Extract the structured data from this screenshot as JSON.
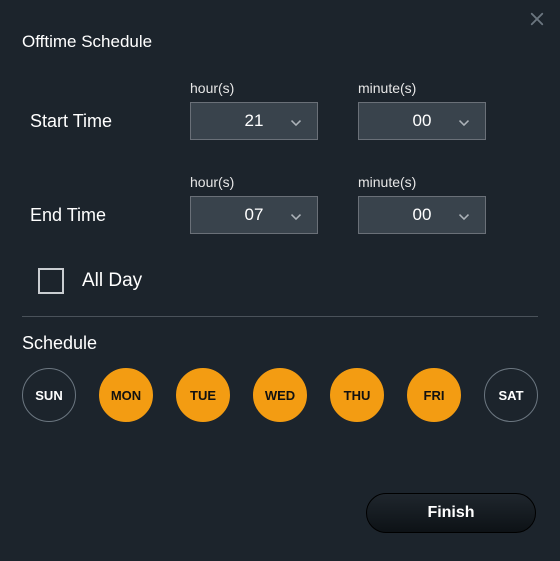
{
  "title": "Offtime Schedule",
  "labels": {
    "startTime": "Start Time",
    "endTime": "End Time",
    "hours": "hour(s)",
    "minutes": "minute(s)",
    "allDay": "All Day",
    "schedule": "Schedule",
    "finish": "Finish"
  },
  "startHour": "21",
  "startMinute": "00",
  "endHour": "07",
  "endMinute": "00",
  "allDayChecked": false,
  "days": [
    {
      "abbr": "SUN",
      "selected": false
    },
    {
      "abbr": "MON",
      "selected": true
    },
    {
      "abbr": "TUE",
      "selected": true
    },
    {
      "abbr": "WED",
      "selected": true
    },
    {
      "abbr": "THU",
      "selected": true
    },
    {
      "abbr": "FRI",
      "selected": true
    },
    {
      "abbr": "SAT",
      "selected": false
    }
  ],
  "colors": {
    "accent": "#f39c12",
    "panel": "#1c242c",
    "selectBg": "#39434c"
  }
}
